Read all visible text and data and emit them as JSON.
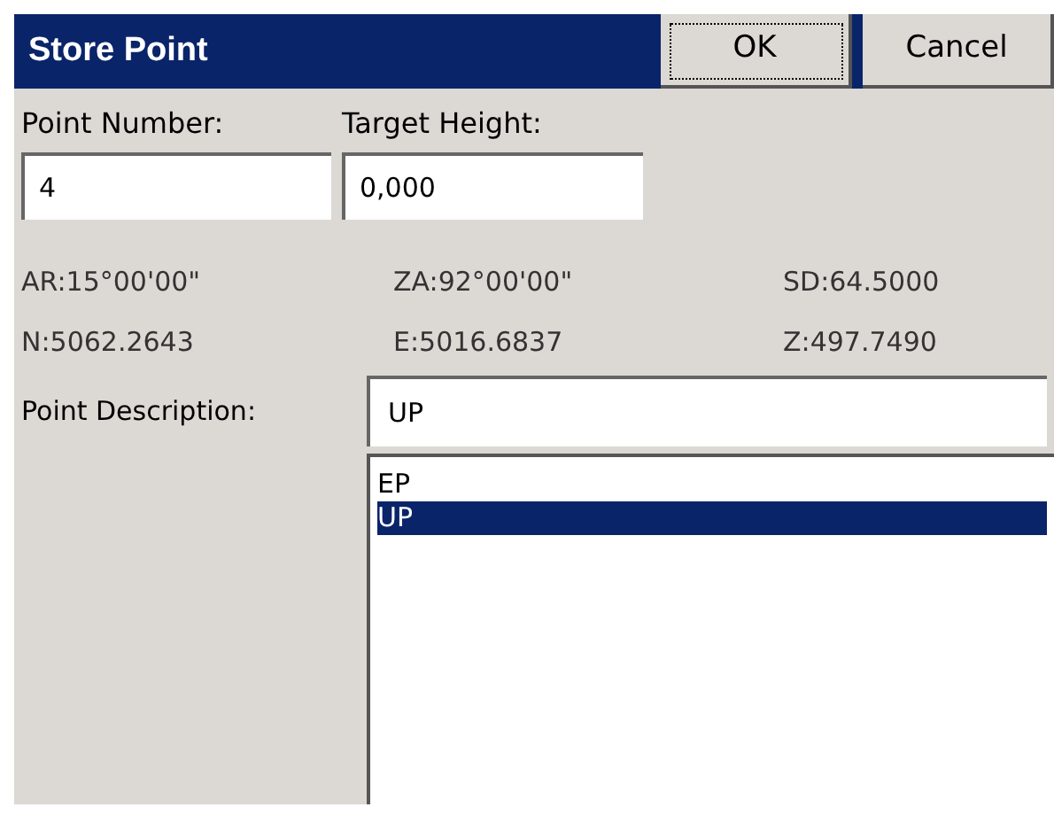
{
  "window": {
    "title": "Store Point"
  },
  "buttons": [
    {
      "label": "OK",
      "focused": true
    },
    {
      "label": "Cancel",
      "focused": false
    }
  ],
  "fields": [
    {
      "label": "Point Number:",
      "value": "4"
    },
    {
      "label": "Target Height:",
      "value": "0,000"
    }
  ],
  "readings": [
    "AR:15°00'00\"",
    "ZA:92°00'00\"",
    "SD:64.5000",
    "N:5062.2643",
    "E:5016.6837",
    "Z:497.7490"
  ],
  "description": {
    "label": "Point Description:",
    "value": "UP"
  },
  "list": [
    {
      "label": "EP",
      "selected": false
    },
    {
      "label": "UP",
      "selected": true
    }
  ]
}
